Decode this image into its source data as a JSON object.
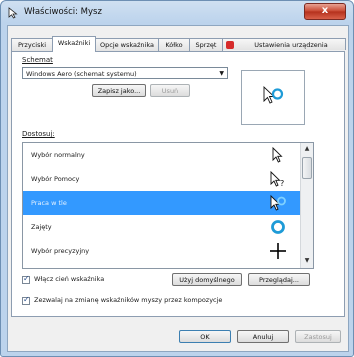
{
  "window": {
    "title": "Właściwości: Mysz",
    "close_glyph": "x"
  },
  "tabs": [
    {
      "label": "Przyciski"
    },
    {
      "label": "Wskaźniki"
    },
    {
      "label": "Opcje wskaźnika"
    },
    {
      "label": "Kółko"
    },
    {
      "label": "Sprzęt"
    },
    {
      "label": "Ustawienia urządzenia"
    }
  ],
  "scheme": {
    "label": "Schemat",
    "selected": "Windows Aero (schemat systemu)",
    "save_as": "Zapisz jako...",
    "delete": "Usuń"
  },
  "customize": {
    "label": "Dostosuj:",
    "items": [
      {
        "label": "Wybór normalny",
        "icon": "arrow-cursor-icon"
      },
      {
        "label": "Wybór Pomocy",
        "icon": "help-cursor-icon"
      },
      {
        "label": "Praca w tle",
        "icon": "working-in-background-cursor-icon",
        "selected": true
      },
      {
        "label": "Zajęty",
        "icon": "busy-cursor-icon"
      },
      {
        "label": "Wybór precyzyjny",
        "icon": "crosshair-cursor-icon"
      }
    ]
  },
  "options": {
    "enable_shadow": "Włącz cień wskaźnika",
    "use_default": "Użyj domyślnego",
    "browse": "Przeglądaj...",
    "allow_themes": "Zezwalaj na zmianę wskaźników myszy przez kompozycje"
  },
  "footer": {
    "ok": "OK",
    "cancel": "Anuluj",
    "apply": "Zastosuj"
  },
  "colors": {
    "selection": "#3399ff",
    "accent_title": "#bcd3ec",
    "close": "#c7452f",
    "busy_ring": "#1e9bd7"
  }
}
